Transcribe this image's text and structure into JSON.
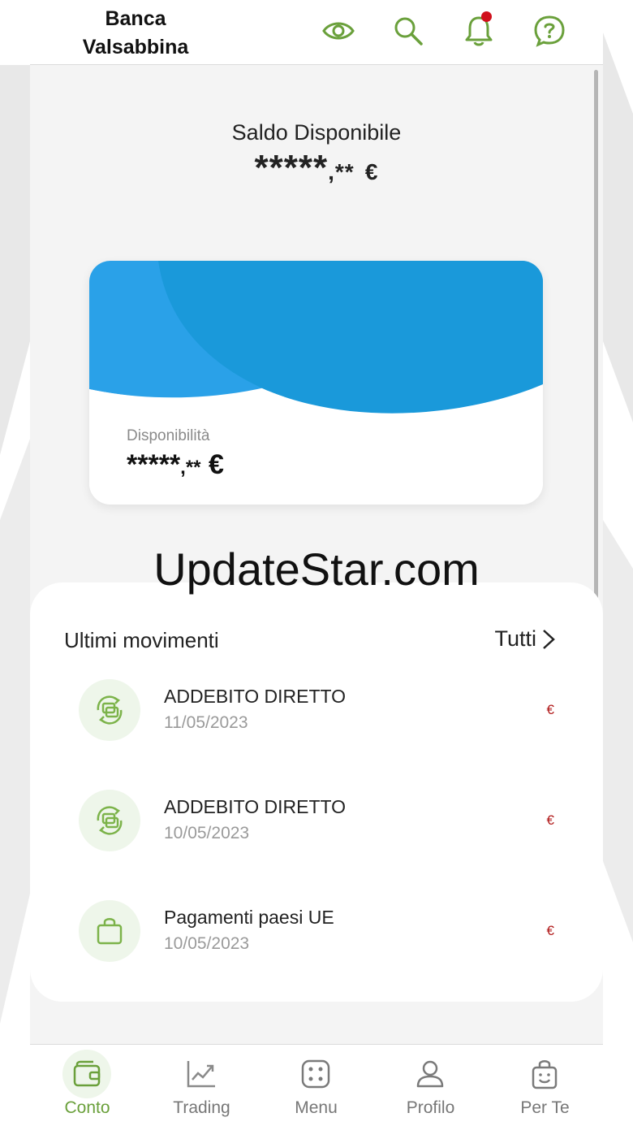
{
  "colors": {
    "brand_green": "#6aa03b",
    "card_blue": "#1a99da",
    "card_blue_light": "#2aa1e8",
    "notification_red": "#d0101c",
    "amount_red": "#b01818"
  },
  "header": {
    "brand_line1": "Banca",
    "brand_line2": "Valsabbina",
    "icons": [
      "eye-icon",
      "search-icon",
      "bell-icon",
      "help-icon"
    ]
  },
  "balance": {
    "label": "Saldo Disponibile",
    "masked_main": "*****",
    "masked_cents": ",**",
    "currency": "€"
  },
  "card": {
    "availability_label": "Disponibilità",
    "masked_main": "*****",
    "masked_cents": ",**",
    "currency": "€"
  },
  "watermark": "UpdateStar.com",
  "movements": {
    "title": "Ultimi movimenti",
    "see_all": "Tutti",
    "items": [
      {
        "name": "ADDEBITO DIRETTO",
        "date": "11/05/2023",
        "amount": "€",
        "icon": "transfer-icon"
      },
      {
        "name": "ADDEBITO DIRETTO",
        "date": "10/05/2023",
        "amount": "€",
        "icon": "transfer-icon"
      },
      {
        "name": "Pagamenti paesi UE",
        "date": "10/05/2023",
        "amount": "€",
        "icon": "shopping-bag-icon"
      }
    ]
  },
  "nav": {
    "items": [
      {
        "label": "Conto",
        "icon": "wallet-icon",
        "active": true
      },
      {
        "label": "Trading",
        "icon": "chart-icon",
        "active": false
      },
      {
        "label": "Menu",
        "icon": "dice-menu-icon",
        "active": false
      },
      {
        "label": "Profilo",
        "icon": "user-icon",
        "active": false
      },
      {
        "label": "Per Te",
        "icon": "gift-bag-icon",
        "active": false
      }
    ]
  }
}
